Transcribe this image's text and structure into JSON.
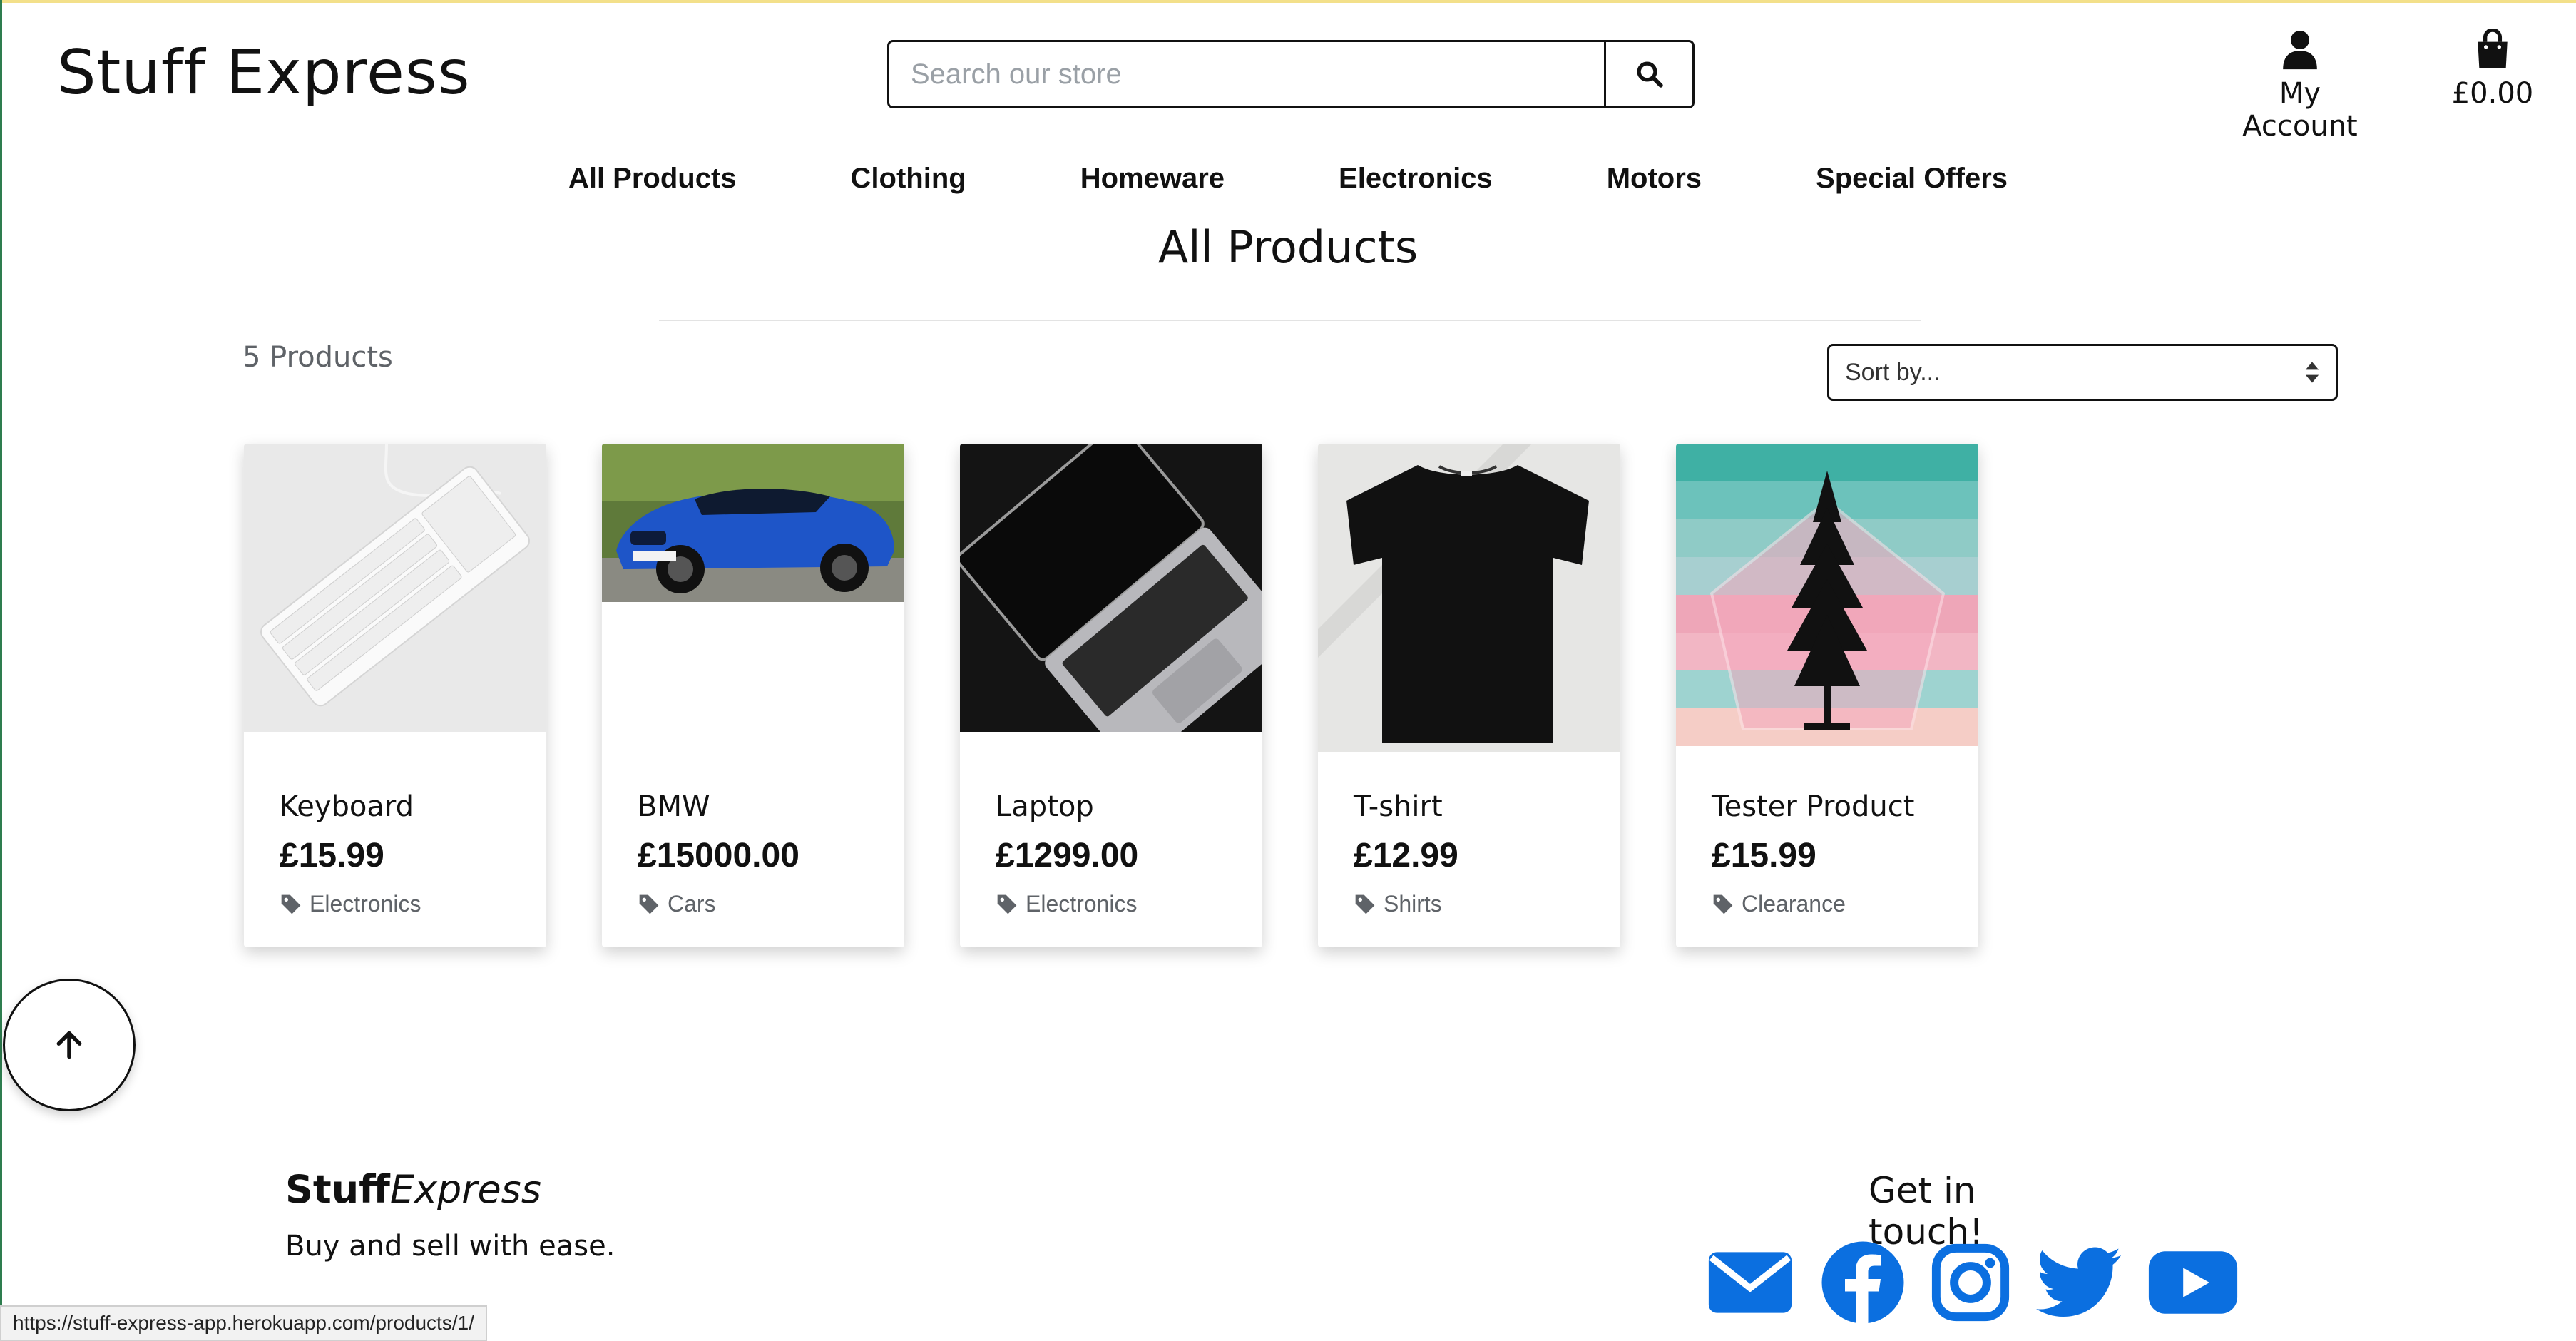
{
  "header": {
    "logo": "Stuff Express",
    "search_placeholder": "Search our store",
    "account_label": "My Account",
    "bag_total": "£0.00"
  },
  "nav": {
    "items": [
      "All Products",
      "Clothing",
      "Homeware",
      "Electronics",
      "Motors",
      "Special Offers"
    ]
  },
  "main": {
    "title": "All Products",
    "count": "5 Products",
    "sort_label": "Sort by..."
  },
  "products": [
    {
      "name": "Keyboard",
      "price": "£15.99",
      "category": "Electronics"
    },
    {
      "name": "BMW",
      "price": "£15000.00",
      "category": "Cars"
    },
    {
      "name": "Laptop",
      "price": "£1299.00",
      "category": "Electronics"
    },
    {
      "name": "T-shirt",
      "price": "£12.99",
      "category": "Shirts"
    },
    {
      "name": "Tester Product",
      "price": "£15.99",
      "category": "Clearance"
    }
  ],
  "footer": {
    "brand_bold": "Stuff",
    "brand_italic": "Express",
    "tagline": "Buy and sell with ease.",
    "contact_heading": "Get in touch!",
    "social_color": "#0b6fe0"
  },
  "status_url": "https://stuff-express-app.herokuapp.com/products/1/"
}
